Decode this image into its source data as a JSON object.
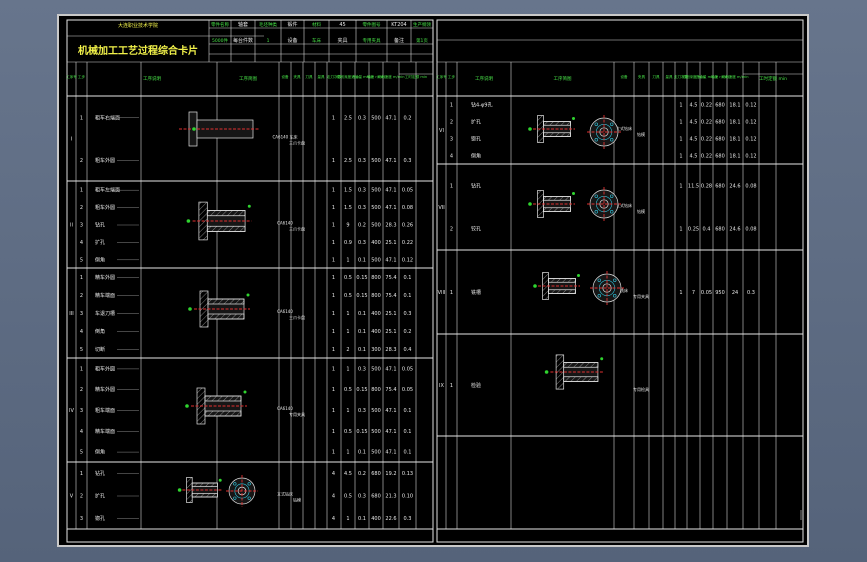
{
  "card": {
    "title": "机械加工工艺过程综合卡片",
    "school": "大连职业技术学院",
    "header_cells": [
      "零件名称",
      "轴套",
      "毛坯种类",
      "锻件",
      "材料",
      "45",
      "零件图号",
      "KT204",
      "生产纲领",
      "5000件",
      "每台件数",
      "1",
      "设备",
      "车床",
      "夹具",
      "专用夹具",
      "备注",
      "第1页"
    ],
    "columns_left": [
      "工序号",
      "工步",
      "工序说明",
      "工序简图",
      "设备",
      "夹具",
      "刀具",
      "量具",
      "走刀次数",
      "切削深度 mm",
      "进给量 mm/r",
      "转速 r/min",
      "切削速度 m/min",
      "工时定额 min"
    ],
    "columns_right": [
      "工序号",
      "工步",
      "工序说明",
      "工序简图",
      "设备",
      "夹具",
      "刀具",
      "量具",
      "走刀次数",
      "切削深度 mm",
      "进给量 mm/r",
      "转速 r/min",
      "切削速度 m/min",
      "工时定额 min"
    ]
  },
  "left_ops": [
    {
      "no": "I",
      "steps": [
        {
          "n": "1",
          "text": "粗车右端面",
          "d": "1",
          "ap": "2.5",
          "f": "0.3",
          "n_rpm": "500",
          "v": "47.1",
          "t": "0.2"
        },
        {
          "n": "2",
          "text": "粗车外圆",
          "d": "1",
          "ap": "2.5",
          "f": "0.3",
          "n_rpm": "500",
          "v": "47.1",
          "t": "0.3"
        }
      ],
      "equip": "CA6140 车床",
      "fixture": "三爪卡盘"
    },
    {
      "no": "II",
      "steps": [
        {
          "n": "1",
          "text": "粗车左端面",
          "d": "1",
          "ap": "1.5",
          "f": "0.3",
          "n_rpm": "500",
          "v": "47.1",
          "t": "0.05"
        },
        {
          "n": "2",
          "text": "粗车外圆",
          "d": "1",
          "ap": "1.5",
          "f": "0.3",
          "n_rpm": "500",
          "v": "47.1",
          "t": "0.08"
        },
        {
          "n": "3",
          "text": "钻孔",
          "d": "1",
          "ap": "9",
          "f": "0.2",
          "n_rpm": "500",
          "v": "28.3",
          "t": "0.26"
        },
        {
          "n": "4",
          "text": "扩孔",
          "d": "1",
          "ap": "0.9",
          "f": "0.3",
          "n_rpm": "400",
          "v": "25.1",
          "t": "0.22"
        },
        {
          "n": "5",
          "text": "倒角",
          "d": "1",
          "ap": "1",
          "f": "0.1",
          "n_rpm": "500",
          "v": "47.1",
          "t": "0.12"
        }
      ],
      "equip": "CA6140",
      "fixture": "三爪卡盘"
    },
    {
      "no": "III",
      "steps": [
        {
          "n": "1",
          "text": "精车外圆",
          "d": "1",
          "ap": "0.5",
          "f": "0.15",
          "n_rpm": "800",
          "v": "75.4",
          "t": "0.1"
        },
        {
          "n": "2",
          "text": "精车端面",
          "d": "1",
          "ap": "0.5",
          "f": "0.15",
          "n_rpm": "800",
          "v": "75.4",
          "t": "0.1"
        },
        {
          "n": "3",
          "text": "车退刀槽",
          "d": "1",
          "ap": "1",
          "f": "0.1",
          "n_rpm": "400",
          "v": "25.1",
          "t": "0.3"
        },
        {
          "n": "4",
          "text": "倒角",
          "d": "1",
          "ap": "1",
          "f": "0.1",
          "n_rpm": "400",
          "v": "25.1",
          "t": "0.2"
        },
        {
          "n": "5",
          "text": "切断",
          "d": "1",
          "ap": "2",
          "f": "0.1",
          "n_rpm": "300",
          "v": "28.3",
          "t": "0.4"
        }
      ],
      "equip": "CA6140",
      "fixture": "三爪卡盘"
    },
    {
      "no": "IV",
      "steps": [
        {
          "n": "1",
          "text": "粗车外圆",
          "d": "1",
          "ap": "1",
          "f": "0.3",
          "n_rpm": "500",
          "v": "47.1",
          "t": "0.05"
        },
        {
          "n": "2",
          "text": "精车外圆",
          "d": "1",
          "ap": "0.5",
          "f": "0.15",
          "n_rpm": "800",
          "v": "75.4",
          "t": "0.05"
        },
        {
          "n": "3",
          "text": "粗车端面",
          "d": "1",
          "ap": "1",
          "f": "0.3",
          "n_rpm": "500",
          "v": "47.1",
          "t": "0.1"
        },
        {
          "n": "4",
          "text": "精车端面",
          "d": "1",
          "ap": "0.5",
          "f": "0.15",
          "n_rpm": "500",
          "v": "47.1",
          "t": "0.1"
        },
        {
          "n": "5",
          "text": "倒角",
          "d": "1",
          "ap": "1",
          "f": "0.1",
          "n_rpm": "500",
          "v": "47.1",
          "t": "0.1"
        }
      ],
      "equip": "CA6140",
      "fixture": "专用夹具"
    },
    {
      "no": "V",
      "steps": [
        {
          "n": "1",
          "text": "钻孔",
          "d": "4",
          "ap": "4.5",
          "f": "0.2",
          "n_rpm": "680",
          "v": "19.2",
          "t": "0.13"
        },
        {
          "n": "2",
          "text": "扩孔",
          "d": "4",
          "ap": "0.5",
          "f": "0.3",
          "n_rpm": "680",
          "v": "21.3",
          "t": "0.10"
        },
        {
          "n": "3",
          "text": "锪孔",
          "d": "4",
          "ap": "1",
          "f": "0.1",
          "n_rpm": "400",
          "v": "22.6",
          "t": "0.3"
        }
      ],
      "equip": "立式钻床",
      "fixture": "钻模"
    }
  ],
  "right_ops": [
    {
      "no": "VI",
      "steps": [
        {
          "n": "1",
          "text": "钻4-φ9孔",
          "d": "1",
          "ap": "4.5",
          "f": "0.22",
          "n_rpm": "680",
          "v": "18.1",
          "t": "0.12"
        },
        {
          "n": "2",
          "text": "扩孔",
          "d": "1",
          "ap": "4.5",
          "f": "0.22",
          "n_rpm": "680",
          "v": "18.1",
          "t": "0.12"
        },
        {
          "n": "3",
          "text": "锪孔",
          "d": "1",
          "ap": "4.5",
          "f": "0.22",
          "n_rpm": "680",
          "v": "18.1",
          "t": "0.12"
        },
        {
          "n": "4",
          "text": "倒角",
          "d": "1",
          "ap": "4.5",
          "f": "0.22",
          "n_rpm": "680",
          "v": "18.1",
          "t": "0.12"
        }
      ],
      "equip": "立式钻床",
      "fixture": "钻模"
    },
    {
      "no": "VII",
      "steps": [
        {
          "n": "1",
          "text": "钻孔",
          "d": "1",
          "ap": "11.5",
          "f": "0.28",
          "n_rpm": "680",
          "v": "24.6",
          "t": "0.08"
        },
        {
          "n": "2",
          "text": "铰孔",
          "d": "1",
          "ap": "0.25",
          "f": "0.4",
          "n_rpm": "680",
          "v": "24.6",
          "t": "0.08"
        }
      ],
      "equip": "立式钻床",
      "fixture": "钻模"
    },
    {
      "no": "VIII",
      "steps": [
        {
          "n": "1",
          "text": "铣槽",
          "d": "1",
          "ap": "7",
          "f": "0.05",
          "n_rpm": "950",
          "v": "24",
          "t": "0.3"
        }
      ],
      "equip": "铣床",
      "fixture": "专用夹具"
    },
    {
      "no": "IX",
      "steps": [
        {
          "n": "1",
          "text": "检验",
          "d": "",
          "ap": "",
          "f": "",
          "n_rpm": "",
          "v": "",
          "t": ""
        }
      ],
      "equip": "",
      "fixture": "专用检具"
    }
  ]
}
